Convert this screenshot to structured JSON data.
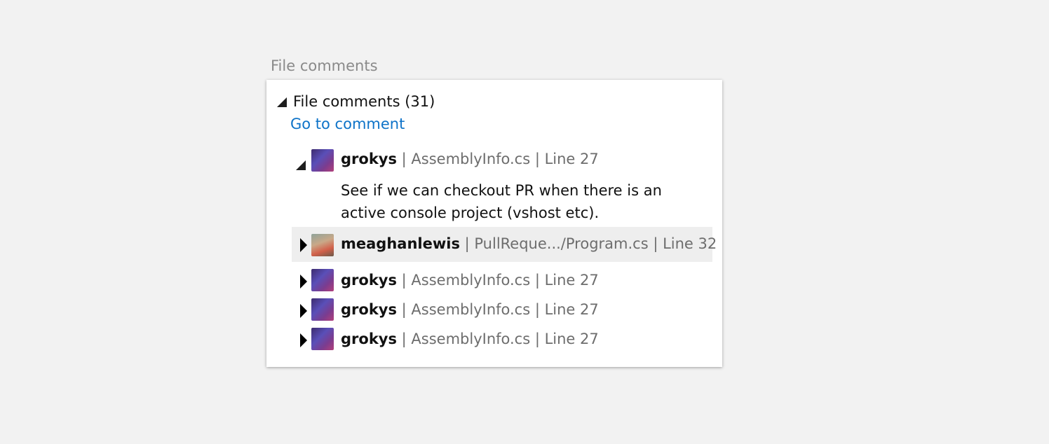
{
  "caption": "File comments",
  "panel": {
    "header_title": "File comments (31)",
    "goto_label": "Go to comment",
    "threads": [
      {
        "author": "grokys",
        "meta": " | AssemblyInfo.cs | Line 27",
        "expanded": true,
        "body": "See if we can checkout PR when there is an active console project (vshost etc)."
      },
      {
        "author": "meaghanlewis",
        "meta": " | PullReque.../Program.cs | Line 32",
        "expanded": false,
        "selected": true
      },
      {
        "author": "grokys",
        "meta": " | AssemblyInfo.cs | Line 27",
        "expanded": false
      },
      {
        "author": "grokys",
        "meta": " | AssemblyInfo.cs | Line 27",
        "expanded": false
      },
      {
        "author": "grokys",
        "meta": " | AssemblyInfo.cs | Line 27",
        "expanded": false
      }
    ]
  },
  "icons": {
    "expand": "triangle-down-icon",
    "collapsed": "triangle-right-icon"
  }
}
